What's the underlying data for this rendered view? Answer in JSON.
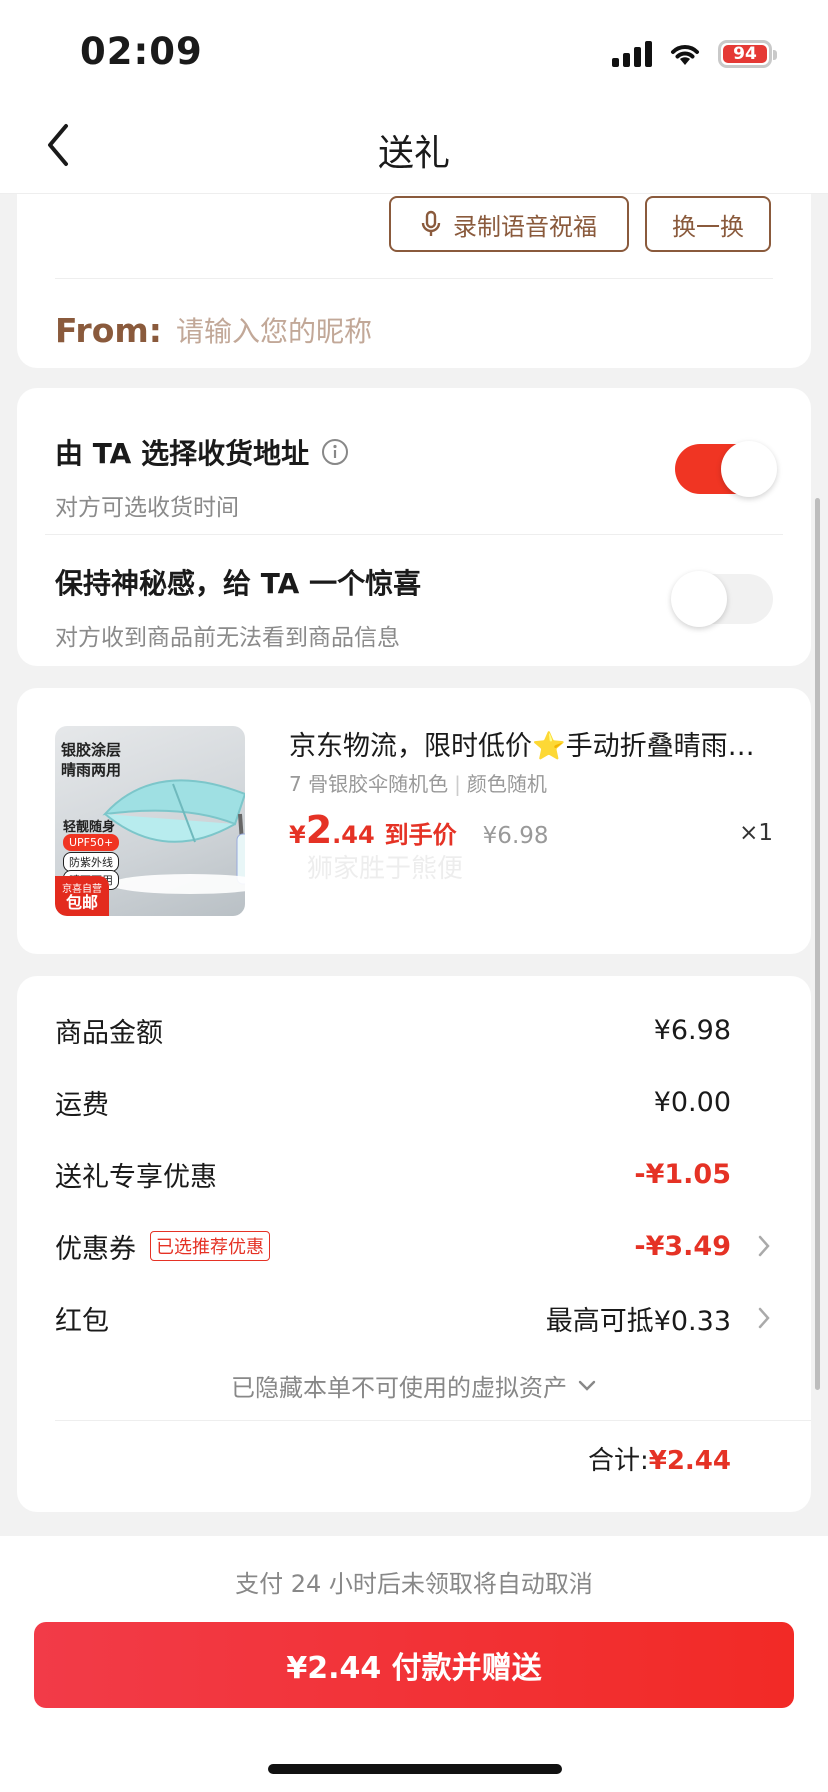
{
  "status_bar": {
    "time": "02:09",
    "battery": "94"
  },
  "header": {
    "title": "送礼"
  },
  "greeting": {
    "voice_button": "录制语音祝福",
    "change_button": "换一换",
    "from_label": "From:",
    "from_placeholder": "请输入您的昵称"
  },
  "options": {
    "address": {
      "title": "由 TA 选择收货地址",
      "subtitle": "对方可选收货时间",
      "enabled": true
    },
    "mystery": {
      "title": "保持神秘感，给 TA 一个惊喜",
      "subtitle": "对方收到商品前无法看到商品信息",
      "enabled": false
    }
  },
  "product": {
    "title": "京东物流，限时低价⭐手动折叠晴雨伞银胶防晒",
    "spec_1": "7 骨银胶伞随机色",
    "spec_2": "颜色随机",
    "price_symbol": "¥",
    "price_int": "2",
    "price_dec": ".44",
    "price_label": "到手价",
    "original_price": "¥6.98",
    "quantity": "×1",
    "watermark": "狮家胜于熊便",
    "image": {
      "line1": "银胶涂层",
      "line2": "晴雨两用",
      "line3": "轻靓随身",
      "tag1": "UPF50+",
      "tag2": "防紫外线",
      "tag3": "晴雨两用",
      "badge_top": "京喜自营",
      "badge_bottom": "包邮"
    }
  },
  "fees": {
    "goods_label": "商品金额",
    "goods_value": "¥6.98",
    "shipping_label": "运费",
    "shipping_value": "¥0.00",
    "gift_discount_label": "送礼专享优惠",
    "gift_discount_value": "-¥1.05",
    "coupon_label": "优惠券",
    "coupon_tag": "已选推荐优惠",
    "coupon_value": "-¥3.49",
    "redpacket_label": "红包",
    "redpacket_value": "最高可抵¥0.33",
    "hidden_assets": "已隐藏本单不可使用的虚拟资产",
    "total_label": "合计:",
    "total_value": "¥2.44"
  },
  "footer": {
    "notice": "支付 24 小时后未领取将自动取消",
    "pay_button": "¥2.44 付款并赠送"
  },
  "colors": {
    "accent_red": "#e53225",
    "brown": "#8a5a3c",
    "toggle_on": "#f03523"
  }
}
